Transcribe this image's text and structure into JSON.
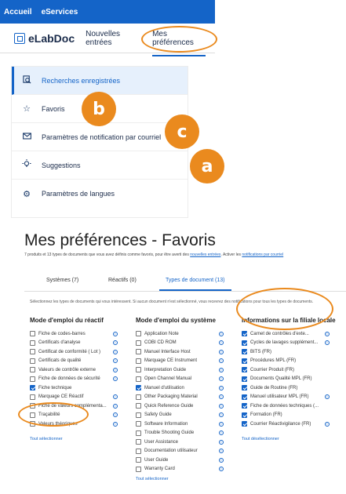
{
  "topbar": {
    "links": [
      "Accueil",
      "eServices"
    ],
    "logo_text": "eLabDoc",
    "nav": [
      "Nouvelles entrées",
      "Mes préférences"
    ]
  },
  "menu": {
    "items": [
      {
        "label": "Recherches enregistrées",
        "icon": "saved-search-icon",
        "selected": true
      },
      {
        "label": "Favoris",
        "icon": "star-icon"
      },
      {
        "label": "Paramètres de notification par courriel",
        "icon": "mail-icon"
      },
      {
        "label": "Suggestions",
        "icon": "lightbulb-icon"
      },
      {
        "label": "Paramètres de langues",
        "icon": "gear-icon"
      }
    ]
  },
  "badges": {
    "a": "a",
    "b": "b",
    "c": "c"
  },
  "favorites": {
    "title": "Mes préférences - Favoris",
    "description_prefix": "7 produits et 13 types de documents que vous avez définis comme favoris, pour être averti des ",
    "description_link1": "nouvelles entrées",
    "description_middle": ". Activer les ",
    "description_link2": "notifications par courriel",
    "tabs": [
      "Systèmes (7)",
      "Réactifs (0)",
      "Types de document (13)"
    ],
    "helper": "Sélectionnez les types de documents qui vous intéressent. Si aucun document n'est sélectionné, vous recevrez des notifications pour tous les types de documents.",
    "columns": [
      {
        "header": "Mode d'emploi du réactif",
        "items": [
          {
            "label": "Fiche de codes-barres",
            "checked": false
          },
          {
            "label": "Certificats d'analyse",
            "checked": false
          },
          {
            "label": "Certificat de conformité ( Lot )",
            "checked": false
          },
          {
            "label": "Certificats de qualité",
            "checked": false
          },
          {
            "label": "Valeurs de contrôle externe",
            "checked": false
          },
          {
            "label": "Fiche de données de sécurité",
            "checked": false
          },
          {
            "label": "Fiche technique",
            "checked": true
          },
          {
            "label": "Marquage CE Réactif",
            "checked": false
          },
          {
            "label": "Fiche de valeurs complémenta...",
            "checked": false
          },
          {
            "label": "Traçabilité",
            "checked": false
          },
          {
            "label": "Valeurs théoriques",
            "checked": false
          }
        ],
        "action": "Tout sélectionner"
      },
      {
        "header": "Mode d'emploi du système",
        "items": [
          {
            "label": "Application Note",
            "checked": false
          },
          {
            "label": "COBI CD ROM",
            "checked": false
          },
          {
            "label": "Manuel Interface Host",
            "checked": false
          },
          {
            "label": "Marquage CE Instrument",
            "checked": false
          },
          {
            "label": "Interpretation Guide",
            "checked": false
          },
          {
            "label": "Open Channel Manual",
            "checked": false
          },
          {
            "label": "Manuel d'utilisation",
            "checked": true
          },
          {
            "label": "Other Packaging Material",
            "checked": false
          },
          {
            "label": "Quick Reference Guide",
            "checked": false
          },
          {
            "label": "Safety Guide",
            "checked": false
          },
          {
            "label": "Software Information",
            "checked": false
          },
          {
            "label": "Trouble Shooting Guide",
            "checked": false
          },
          {
            "label": "User Assistance",
            "checked": false
          },
          {
            "label": "Documentation utilisateur",
            "checked": false
          },
          {
            "label": "User Guide",
            "checked": false
          },
          {
            "label": "Warranty Card",
            "checked": false
          }
        ],
        "action": "Tout sélectionner"
      },
      {
        "header": "Informations sur la filiale locale",
        "items": [
          {
            "label": "Carnet de contrôles d'exte...",
            "checked": true
          },
          {
            "label": "Cycles de lavages supplément...",
            "checked": true
          },
          {
            "label": "BITS (FR)",
            "checked": true
          },
          {
            "label": "Procédures MPL (FR)",
            "checked": true
          },
          {
            "label": "Courrier Produit (FR)",
            "checked": true
          },
          {
            "label": "Documents Qualité MPL (FR)",
            "checked": true
          },
          {
            "label": "Guide de Routine (FR)",
            "checked": true
          },
          {
            "label": "Manuel utilisateur MPL (FR)",
            "checked": true
          },
          {
            "label": "Fiche de données techniques (...",
            "checked": true
          },
          {
            "label": "Formation (FR)",
            "checked": true
          },
          {
            "label": "Courrier Réactivigilance (FR)",
            "checked": true
          }
        ],
        "action": "Tout désélectionner"
      }
    ]
  },
  "colors": {
    "accent": "#1464c8",
    "highlight": "#ea8a1e",
    "selected_bg": "#e6f0fc"
  }
}
